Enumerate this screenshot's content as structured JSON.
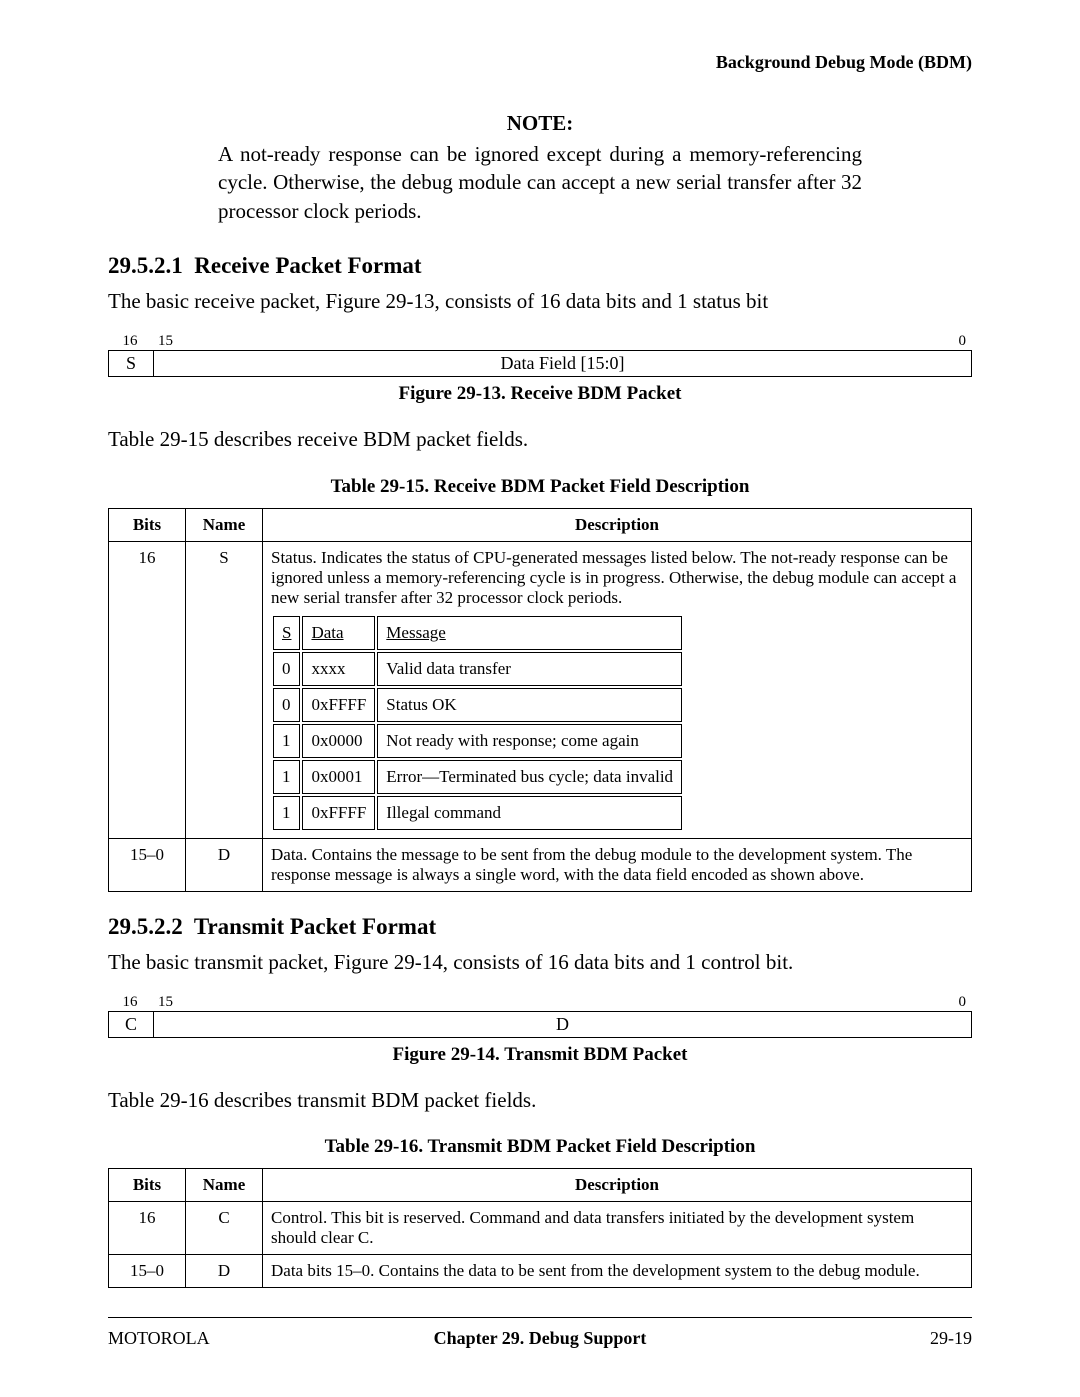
{
  "running_head": "Background Debug Mode (BDM)",
  "note": {
    "title": "NOTE:",
    "body": "A not-ready response can be ignored except during a memory-referencing cycle. Otherwise, the debug module can accept a new serial transfer after 32 processor clock periods."
  },
  "sec1": {
    "num": "29.5.2.1",
    "title": "Receive Packet Format",
    "intro": "The basic receive packet, Figure 29-13, consists of 16 data bits and 1 status bit",
    "fig": {
      "bit_hi_s": "16",
      "bit_hi_d_left": "15",
      "bit_hi_d_right": "0",
      "s_label": "S",
      "d_label": "Data Field [15:0]",
      "caption": "Figure 29-13. Receive BDM Packet"
    },
    "after_fig": "Table 29-15 describes receive BDM packet fields.",
    "table_caption": "Table 29-15. Receive BDM Packet Field Description",
    "table": {
      "headers": {
        "bits": "Bits",
        "name": "Name",
        "desc": "Description"
      },
      "rows": [
        {
          "bits": "16",
          "name": "S",
          "desc_top": "Status. Indicates the status of CPU-generated messages listed below. The not-ready response can be ignored unless a memory-referencing cycle is in progress. Otherwise, the debug module can accept a new serial transfer after 32 processor clock periods.",
          "status_rows": [
            {
              "s": "S",
              "data": "Data",
              "msg": "Message",
              "hdr": true
            },
            {
              "s": "0",
              "data": "xxxx",
              "msg": "Valid data transfer"
            },
            {
              "s": "0",
              "data": "0xFFFF",
              "msg": "Status OK"
            },
            {
              "s": "1",
              "data": "0x0000",
              "msg": "Not ready with response; come again"
            },
            {
              "s": "1",
              "data": "0x0001",
              "msg": "Error—Terminated bus cycle; data invalid"
            },
            {
              "s": "1",
              "data": "0xFFFF",
              "msg": "Illegal command"
            }
          ]
        },
        {
          "bits": "15–0",
          "name": "D",
          "desc_top": "Data. Contains the message to be sent from the debug module to the development system. The response message is always a single word, with the data field encoded as shown above."
        }
      ]
    }
  },
  "sec2": {
    "num": "29.5.2.2",
    "title": "Transmit Packet Format",
    "intro": "The basic transmit packet, Figure 29-14, consists of 16 data bits and 1 control bit.",
    "fig": {
      "bit_hi_s": "16",
      "bit_hi_d_left": "15",
      "bit_hi_d_right": "0",
      "s_label": "C",
      "d_label": "D",
      "caption": "Figure 29-14. Transmit BDM Packet"
    },
    "after_fig": "Table 29-16 describes transmit BDM packet fields.",
    "table_caption": "Table 29-16. Transmit BDM Packet Field Description",
    "table": {
      "headers": {
        "bits": "Bits",
        "name": "Name",
        "desc": "Description"
      },
      "rows": [
        {
          "bits": "16",
          "name": "C",
          "desc_top": "Control. This bit is reserved. Command and data transfers initiated by the development system should clear C."
        },
        {
          "bits": "15–0",
          "name": "D",
          "desc_top": "Data bits 15–0. Contains the data to be sent from the development system to the debug module."
        }
      ]
    }
  },
  "footer": {
    "left": "MOTOROLA",
    "center": "Chapter 29.  Debug Support",
    "right": "29-19"
  }
}
